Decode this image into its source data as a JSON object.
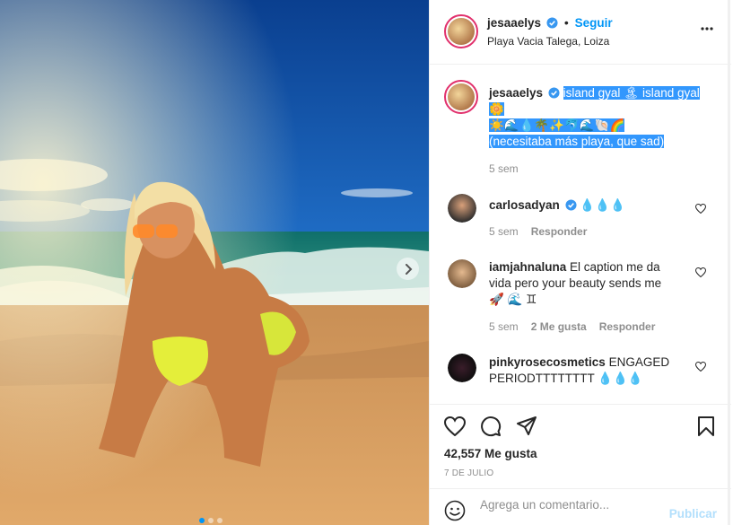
{
  "post": {
    "author": "jesaaelys",
    "follow_sep": "•",
    "follow_label": "Seguir",
    "location": "Playa Vacia Talega, Loiza",
    "caption_author": "jesaaelys",
    "caption_line1": "island gyal 🏝 island gyal",
    "caption_line2": "🌼",
    "caption_line3": "☀️🌊💧🌴✨🐬🌊🐚🌈",
    "caption_line4": "(necesitaba más playa, que sad)",
    "caption_time": "5 sem",
    "likes": "42,557 Me gusta",
    "date": "7 DE JULIO"
  },
  "comments": [
    {
      "user": "carlosadyan",
      "verified": true,
      "text": "💧💧💧",
      "time": "5 sem",
      "likes": "",
      "reply": "Responder"
    },
    {
      "user": "iamjahnaluna",
      "verified": false,
      "text": "El caption me da vida pero your beauty sends me 🚀 🌊 ♊",
      "time": "5 sem",
      "likes": "2 Me gusta",
      "reply": "Responder"
    },
    {
      "user": "pinkyrosecosmetics",
      "verified": false,
      "text": "ENGAGED PERIODTTTTTTTT 💧💧💧",
      "time": "",
      "likes": "",
      "reply": ""
    }
  ],
  "composer": {
    "placeholder": "Agrega un comentario...",
    "publish": "Publicar"
  },
  "icons": {
    "verified": "verified-badge-icon",
    "more": "more-options-icon",
    "like": "heart-icon",
    "comment": "comment-icon",
    "share": "paper-plane-icon",
    "save": "bookmark-icon",
    "emoji": "emoji-icon",
    "next": "chevron-right-icon"
  },
  "colors": {
    "accent": "#0095f6",
    "publish_disabled": "#b2dffc",
    "selection": "#3297fd"
  }
}
